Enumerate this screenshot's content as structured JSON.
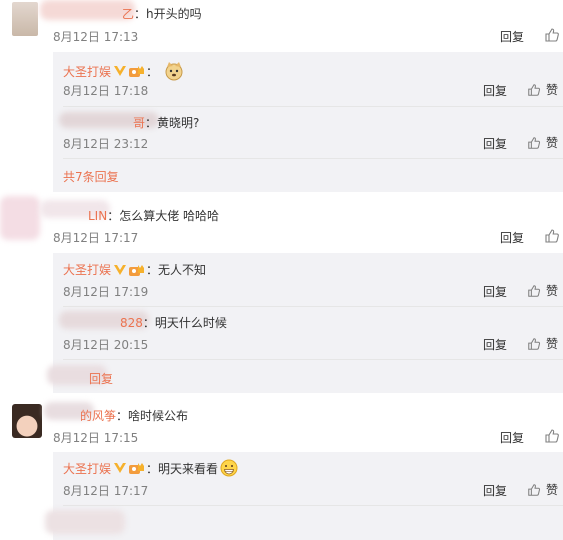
{
  "comments": [
    {
      "name_suffix": "乙",
      "text": "：h开头的吗",
      "time": "8月12日 17:13",
      "reply_label": "回复",
      "replies": [
        {
          "name": "大圣打娱",
          "text": "：",
          "time": "8月12日 17:18",
          "reply_label": "回复",
          "like_label": "赞"
        },
        {
          "name_suffix": "哥",
          "text": "：黄晓明?",
          "time": "8月12日 23:12",
          "reply_label": "回复",
          "like_label": "赞"
        }
      ],
      "more_label": "共7条回复"
    },
    {
      "name_suffix": "LIN",
      "text": "：怎么算大佬 哈哈哈",
      "time": "8月12日 17:17",
      "reply_label": "回复",
      "replies": [
        {
          "name": "大圣打娱",
          "text": "：无人不知",
          "time": "8月12日 17:19",
          "reply_label": "回复",
          "like_label": "赞"
        },
        {
          "name_suffix": "828",
          "text": "：明天什么时候",
          "time": "8月12日 20:15",
          "reply_label": "回复",
          "like_label": "赞"
        }
      ],
      "more_label": "回复"
    },
    {
      "name_suffix": "的风筝",
      "text": "：啥时候公布",
      "time": "8月12日 17:15",
      "reply_label": "回复",
      "replies": [
        {
          "name": "大圣打娱",
          "text": "：明天来看看",
          "time": "8月12日 17:17",
          "reply_label": "回复",
          "like_label": "赞"
        }
      ]
    }
  ],
  "colors": {
    "accent": "#eb7350",
    "reply_bg": "#f2f2f5",
    "verified": "#f6b12c"
  },
  "icons": [
    "thumb-up-icon",
    "verified-v-icon",
    "gold-fan-icon",
    "doge-emoji-icon",
    "grin-emoji-icon"
  ]
}
